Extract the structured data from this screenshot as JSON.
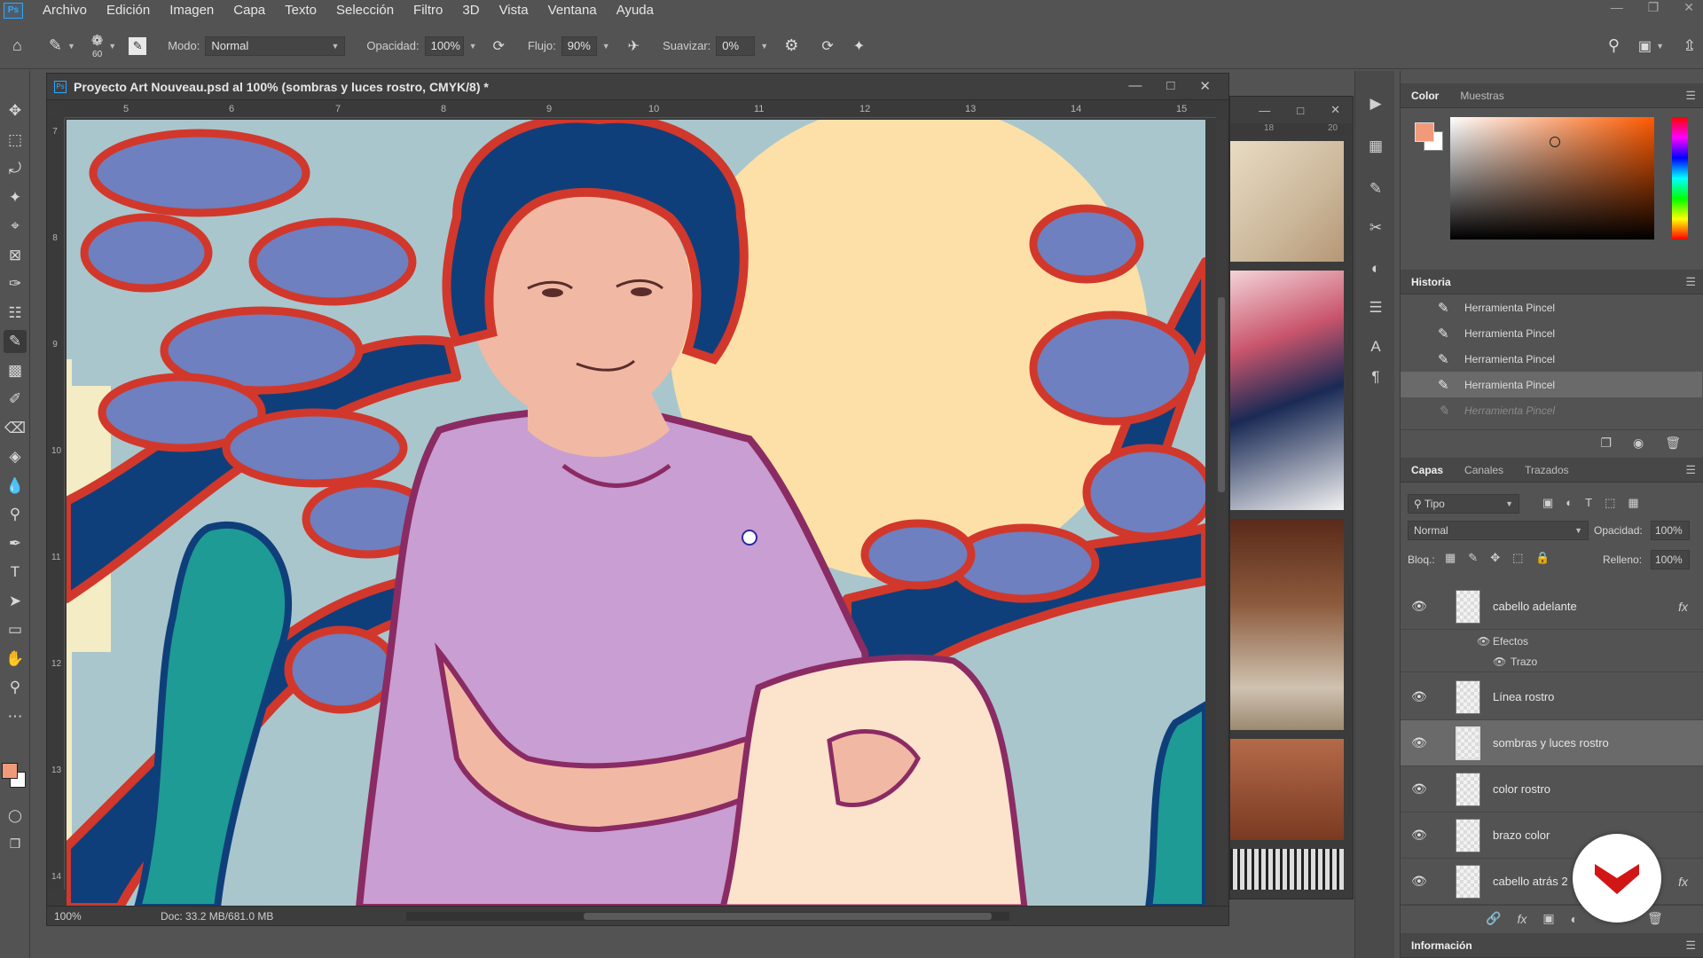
{
  "menu": [
    "Archivo",
    "Edición",
    "Imagen",
    "Capa",
    "Texto",
    "Selección",
    "Filtro",
    "3D",
    "Vista",
    "Ventana",
    "Ayuda"
  ],
  "options": {
    "brush_size": "60",
    "mode_label": "Modo:",
    "mode_value": "Normal",
    "opacity_label": "Opacidad:",
    "opacity_value": "100%",
    "flow_label": "Flujo:",
    "flow_value": "90%",
    "smooth_label": "Suavizar:",
    "smooth_value": "0%"
  },
  "document": {
    "title": "Proyecto Art Nouveau.psd al 100% (sombras y luces rostro, CMYK/8) *",
    "zoom": "100%",
    "doc_info": "Doc: 33.2 MB/681.0 MB",
    "ruler_top": [
      "5",
      "6",
      "7",
      "8",
      "9",
      "10",
      "11",
      "12",
      "13",
      "14",
      "15"
    ],
    "ruler_left": [
      "7",
      "8",
      "9",
      "10",
      "11",
      "12",
      "13",
      "14"
    ]
  },
  "colors": {
    "foreground": "#f09a7a",
    "background": "#ffffff",
    "canvas_sky": "#a9c6cd",
    "moon": "#fce0a8",
    "outline_red": "#d1382b",
    "navy": "#0f3f7a",
    "foliage": "#6e80bf",
    "dress": "#c99ed2",
    "skin": "#f1b9a3",
    "teal": "#1e9b94"
  },
  "ref_window": {
    "ruler_marks": [
      "18",
      "20"
    ]
  },
  "color_panel": {
    "tab_color": "Color",
    "tab_swatches": "Muestras"
  },
  "history": {
    "tab": "Historia",
    "items": [
      {
        "label": "Herramienta Pincel",
        "state": "normal"
      },
      {
        "label": "Herramienta Pincel",
        "state": "normal"
      },
      {
        "label": "Herramienta Pincel",
        "state": "normal"
      },
      {
        "label": "Herramienta Pincel",
        "state": "selected"
      },
      {
        "label": "Herramienta Pincel",
        "state": "undone"
      }
    ]
  },
  "layers": {
    "tabs": [
      "Capas",
      "Canales",
      "Trazados"
    ],
    "filter_label": "Tipo",
    "blend_mode": "Normal",
    "opacity_label": "Opacidad:",
    "opacity_value": "100%",
    "lock_label": "Bloq.:",
    "fill_label": "Relleno:",
    "fill_value": "100%",
    "effects_label": "Efectos",
    "stroke_label": "Trazo",
    "items": [
      {
        "name": "cabello adelante",
        "fx": "fx"
      },
      {
        "name": "Línea rostro",
        "fx": ""
      },
      {
        "name": "sombras y luces rostro",
        "fx": ""
      },
      {
        "name": "color rostro",
        "fx": ""
      },
      {
        "name": "brazo color",
        "fx": ""
      },
      {
        "name": "cabello atrás 2",
        "fx": "fx"
      }
    ]
  },
  "info_panel": {
    "tab": "Información"
  }
}
